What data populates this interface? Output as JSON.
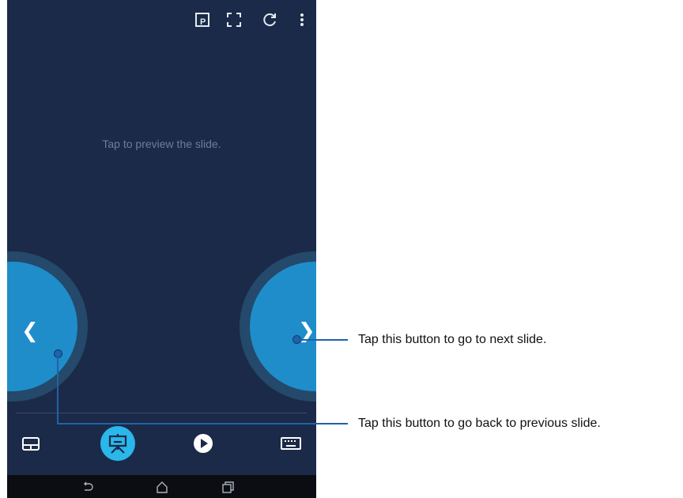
{
  "screen": {
    "hint": "Tap to preview the slide.",
    "prev_chevron": "❮",
    "next_chevron": "❯"
  },
  "topbar": {
    "icons": [
      "presenter-notes-icon",
      "fullscreen-icon",
      "refresh-icon",
      "more-vert-icon"
    ]
  },
  "bottom_toolbar": {
    "tools": [
      "touchpad-icon",
      "presentation-icon",
      "play-icon",
      "keyboard-icon"
    ],
    "active": "presentation-icon"
  },
  "system_nav": [
    "back-icon",
    "home-icon",
    "recents-icon"
  ],
  "callouts": {
    "next": "Tap this button to go to next slide.",
    "prev": "Tap this button to go back to previous slide."
  },
  "colors": {
    "background": "#1b2a48",
    "button_outer": "#24496a",
    "button_inner": "#1f8dca",
    "active_tool": "#2ab7ea",
    "callout": "#1f63a8"
  }
}
